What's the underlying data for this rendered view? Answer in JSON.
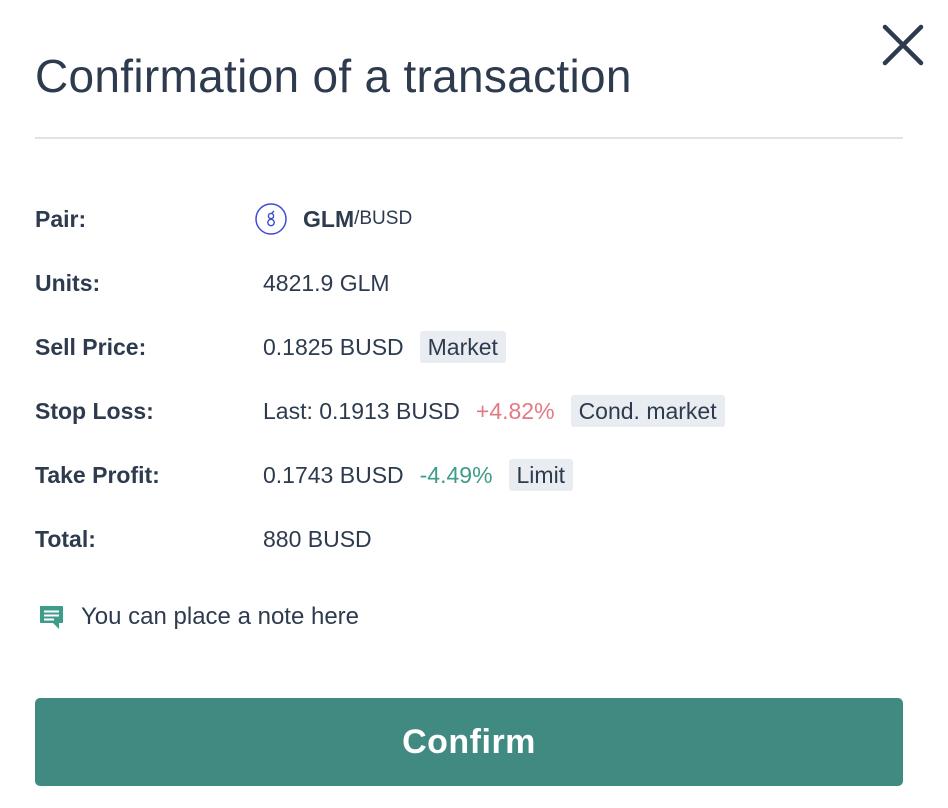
{
  "dialog": {
    "title": "Confirmation of a transaction",
    "close_icon": "close-icon"
  },
  "pair": {
    "label": "Pair:",
    "coin_icon": "golem-coin-icon",
    "base": "GLM",
    "quote": "/BUSD"
  },
  "units": {
    "label": "Units:",
    "value": "4821.9 GLM"
  },
  "sell_price": {
    "label": "Sell Price:",
    "value": "0.1825 BUSD",
    "badge": "Market"
  },
  "stop_loss": {
    "label": "Stop Loss:",
    "value": "Last: 0.1913 BUSD",
    "change": "+4.82%",
    "badge": "Cond. market"
  },
  "take_profit": {
    "label": "Take Profit:",
    "value": "0.1743 BUSD",
    "change": "-4.49%",
    "badge": "Limit"
  },
  "total": {
    "label": "Total:",
    "value": "880 BUSD"
  },
  "note": {
    "icon": "comment-icon",
    "text": "You can place a note here"
  },
  "confirm": {
    "label": "Confirm"
  },
  "colors": {
    "text": "#2e3b4e",
    "accent": "#408a81",
    "positive_change": "#e27a84",
    "negative_change": "#3e9c8b",
    "badge_bg": "#e9edf1",
    "divider": "#dfe3e6",
    "coin": "#3d4bd6"
  }
}
